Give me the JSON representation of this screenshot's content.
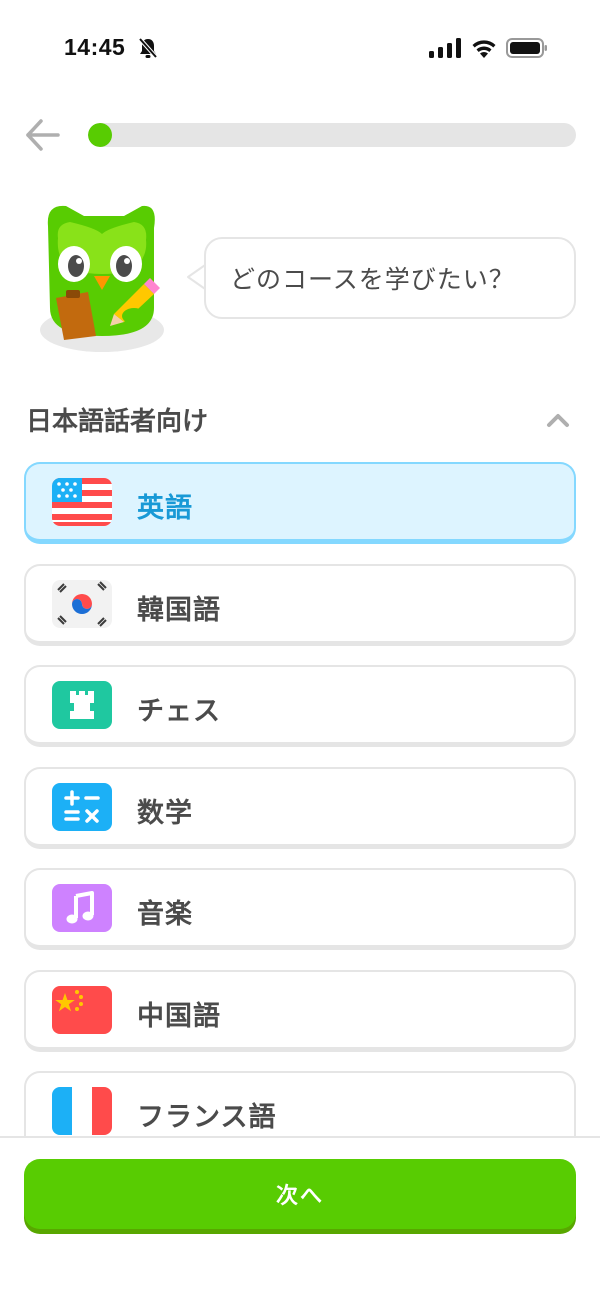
{
  "status_bar": {
    "time": "14:45",
    "icons": [
      "bell-off-icon",
      "cellular-signal-icon",
      "wifi-icon",
      "battery-icon"
    ]
  },
  "header": {
    "back_icon": "arrow-left-icon",
    "progress_fraction": 0.04
  },
  "prompt": {
    "mascot": "owl-mascot",
    "question": "どのコースを学びたい？"
  },
  "section": {
    "title": "日本語話者向け",
    "toggle_icon": "chevron-up-icon"
  },
  "courses": [
    {
      "label": "英語",
      "icon": "us-flag-icon",
      "selected": true
    },
    {
      "label": "韓国語",
      "icon": "korea-flag-icon",
      "selected": false
    },
    {
      "label": "チェス",
      "icon": "chess-rook-icon",
      "selected": false
    },
    {
      "label": "数学",
      "icon": "math-icon",
      "selected": false
    },
    {
      "label": "音楽",
      "icon": "music-note-icon",
      "selected": false
    },
    {
      "label": "中国語",
      "icon": "china-flag-icon",
      "selected": false
    },
    {
      "label": "フランス語",
      "icon": "france-flag-icon",
      "selected": false
    }
  ],
  "footer": {
    "next_label": "次へ"
  },
  "colors": {
    "primary_green": "#58cc02",
    "selected_bg": "#ddf4ff",
    "selected_border": "#84d8ff",
    "selected_text": "#1899d6",
    "border_gray": "#e5e5e5",
    "text_gray": "#4b4b4b"
  }
}
